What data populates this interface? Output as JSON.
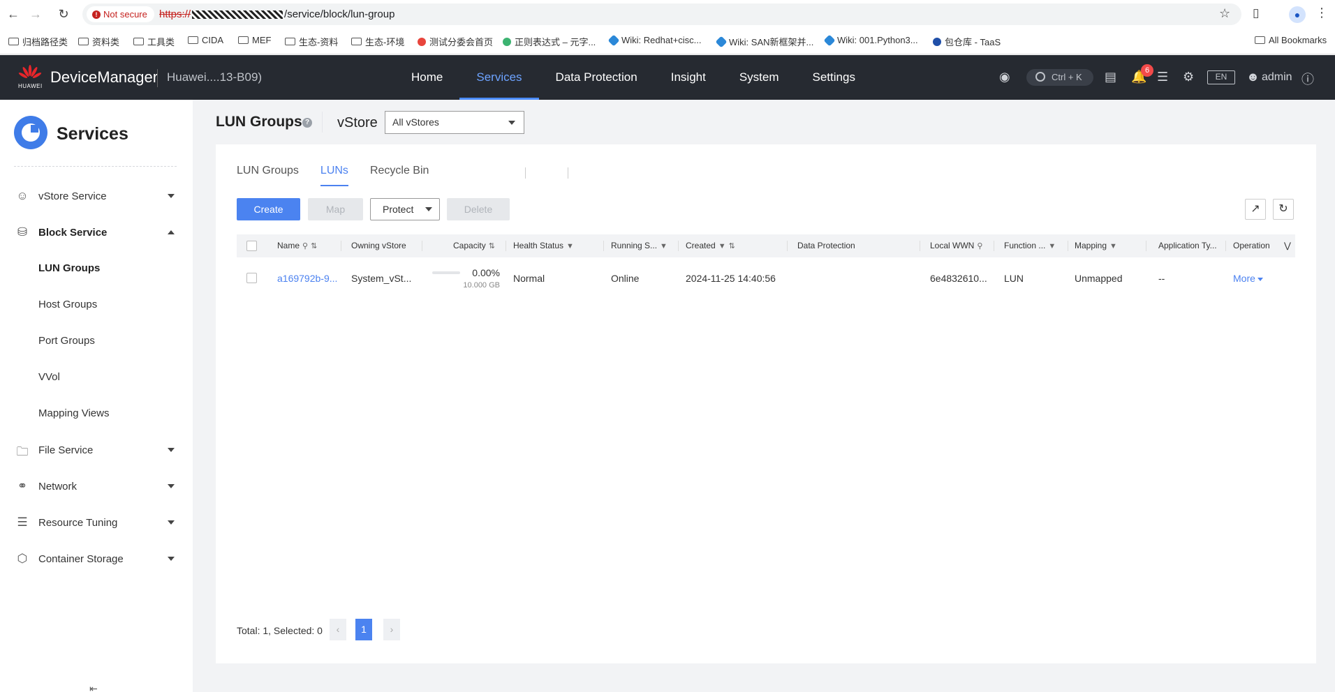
{
  "browser": {
    "not_secure": "Not secure",
    "url_scheme": "https://",
    "url_path": "/service/block/lun-group",
    "bookmarks": [
      "归档路径类",
      "资料类",
      "工具类",
      "CIDA",
      "MEF",
      "生态-资料",
      "生态-环境",
      "测试分委会首页",
      "正则表达式 – 元字...",
      "Wiki: Redhat+cisc...",
      "Wiki: SAN新框架并...",
      "Wiki: 001.Python3...",
      "包仓库 - TaaS"
    ],
    "all_bookmarks": "All Bookmarks"
  },
  "header": {
    "logo_text": "HUAWEI",
    "brand": "DeviceManager",
    "device": "Huawei....13-B09)",
    "nav": [
      "Home",
      "Services",
      "Data Protection",
      "Insight",
      "System",
      "Settings"
    ],
    "search_hint": "Ctrl + K",
    "notification_count": "6",
    "lang": "EN",
    "user": "admin",
    "accent": "#4c8dff"
  },
  "sidebar": {
    "title": "Services",
    "items": [
      {
        "label": "vStore Service",
        "icon": "users-icon"
      },
      {
        "label": "Block Service",
        "icon": "database-icon"
      },
      {
        "label": "File Service",
        "icon": "folder-icon"
      },
      {
        "label": "Network",
        "icon": "planet-icon"
      },
      {
        "label": "Resource Tuning",
        "icon": "layers-icon"
      },
      {
        "label": "Container Storage",
        "icon": "hexagons-icon"
      }
    ],
    "block_sub": [
      "LUN Groups",
      "Host Groups",
      "Port Groups",
      "VVol",
      "Mapping Views"
    ]
  },
  "main": {
    "title": "LUN Groups",
    "vstore_label": "vStore",
    "vstore_value": "All vStores",
    "tabs": [
      "LUN Groups",
      "LUNs",
      "Recycle Bin"
    ],
    "buttons": {
      "create": "Create",
      "map": "Map",
      "protect": "Protect",
      "delete": "Delete"
    },
    "columns": [
      "Name",
      "Owning vStore",
      "Capacity",
      "Health Status",
      "Running S...",
      "Created",
      "Data Protection",
      "Local WWN",
      "Function ...",
      "Mapping",
      "Application Ty...",
      "Operation"
    ],
    "rows": [
      {
        "name": "a169792b-9...",
        "owning_vstore": "System_vSt...",
        "capacity_pct": "0.00%",
        "capacity_used_fraction": 0.0,
        "capacity_size": "10.000 GB",
        "health": "Normal",
        "running": "Online",
        "created": "2024-11-25 14:40:56",
        "data_protection": "",
        "local_wwn": "6e4832610...",
        "function": "LUN",
        "mapping": "Unmapped",
        "app_type": "--",
        "operation": "More"
      }
    ],
    "footer_total": "Total: 1, Selected: 0",
    "current_page": "1"
  }
}
